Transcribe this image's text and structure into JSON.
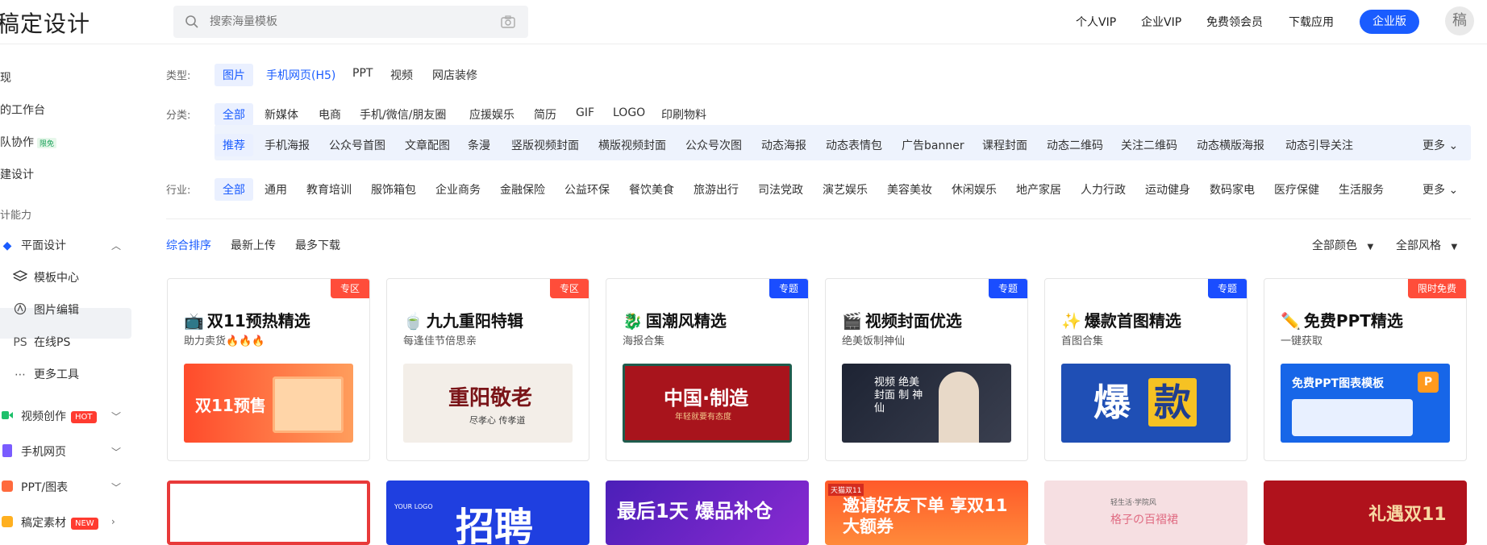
{
  "header": {
    "logo": "稿定设计",
    "search_placeholder": "搜索海量模板",
    "nav": [
      "个人VIP",
      "企业VIP",
      "免费领会员",
      "下载应用"
    ],
    "enterprise_button": "企业版",
    "avatar_text": "稿"
  },
  "sidebar": {
    "items": [
      {
        "label": "现"
      },
      {
        "label": "的工作台"
      },
      {
        "label": "队协作",
        "badge": "限免"
      },
      {
        "label": "建设计"
      },
      {
        "label": "计能力"
      },
      {
        "label": "平面设计"
      },
      {
        "label": "模板中心"
      },
      {
        "label": "图片编辑"
      },
      {
        "label": "在线PS",
        "icon_text": "PS"
      },
      {
        "label": "更多工具"
      },
      {
        "label": "视频创作",
        "badge": "HOT"
      },
      {
        "label": "手机网页"
      },
      {
        "label": "PPT/图表"
      },
      {
        "label": "稿定素材",
        "badge": "NEW"
      }
    ]
  },
  "filters": {
    "type_label": "类型:",
    "types": [
      "图片",
      "手机网页(H5)",
      "PPT",
      "视频",
      "网店装修"
    ],
    "category_label": "分类:",
    "categories": [
      "全部",
      "新媒体",
      "电商",
      "手机/微信/朋友圈",
      "应援娱乐",
      "简历",
      "GIF",
      "LOGO",
      "印刷物料"
    ],
    "sub_categories": [
      "推荐",
      "手机海报",
      "公众号首图",
      "文章配图",
      "条漫",
      "竖版视频封面",
      "横版视频封面",
      "公众号次图",
      "动态海报",
      "动态表情包",
      "广告banner",
      "课程封面",
      "动态二维码",
      "关注二维码",
      "动态横版海报",
      "动态引导关注"
    ],
    "industry_label": "行业:",
    "industries": [
      "全部",
      "通用",
      "教育培训",
      "服饰箱包",
      "企业商务",
      "金融保险",
      "公益环保",
      "餐饮美食",
      "旅游出行",
      "司法党政",
      "演艺娱乐",
      "美容美妆",
      "休闲娱乐",
      "地产家居",
      "人力行政",
      "运动健身",
      "数码家电",
      "医疗保健",
      "生活服务"
    ],
    "more": "更多"
  },
  "sort": {
    "options": [
      "综合排序",
      "最新上传",
      "最多下载"
    ],
    "color_filter": "全部颜色",
    "style_filter": "全部风格"
  },
  "cards": [
    {
      "title": "双11预热精选",
      "subtitle": "助力卖货🔥🔥🔥",
      "tag": "专区",
      "thumb_text": "双11预售"
    },
    {
      "title": "九九重阳特辑",
      "subtitle": "每逢佳节倍思亲",
      "tag": "专区",
      "thumb_text": "重阳敬老",
      "thumb_sub": "尽孝心 传孝道"
    },
    {
      "title": "国潮风精选",
      "subtitle": "海报合集",
      "tag": "专题",
      "thumb_text": "中国·制造",
      "thumb_sub": "年轻就要有态度"
    },
    {
      "title": "视频封面优选",
      "subtitle": "绝美饭制神仙",
      "tag": "专题",
      "thumb_text": "视频 绝美 封面 制 神仙"
    },
    {
      "title": "爆款首图精选",
      "subtitle": "首图合集",
      "tag": "专题",
      "thumb_text1": "爆",
      "thumb_text2": "款"
    },
    {
      "title": "免费PPT精选",
      "subtitle": "一键获取",
      "tag": "限时免费",
      "thumb_text": "免费PPT图表模板"
    }
  ],
  "row2": [
    {
      "text": ""
    },
    {
      "text": "招聘",
      "logo": "YOUR LOGO"
    },
    {
      "text": "最后1天 爆品补仓"
    },
    {
      "text": "邀请好友下单 享双11大额券",
      "corner": "天猫双11"
    },
    {
      "text": "格子の百褶裙",
      "corner": "轻生活·学院风"
    },
    {
      "text": "礼遇双11"
    }
  ]
}
